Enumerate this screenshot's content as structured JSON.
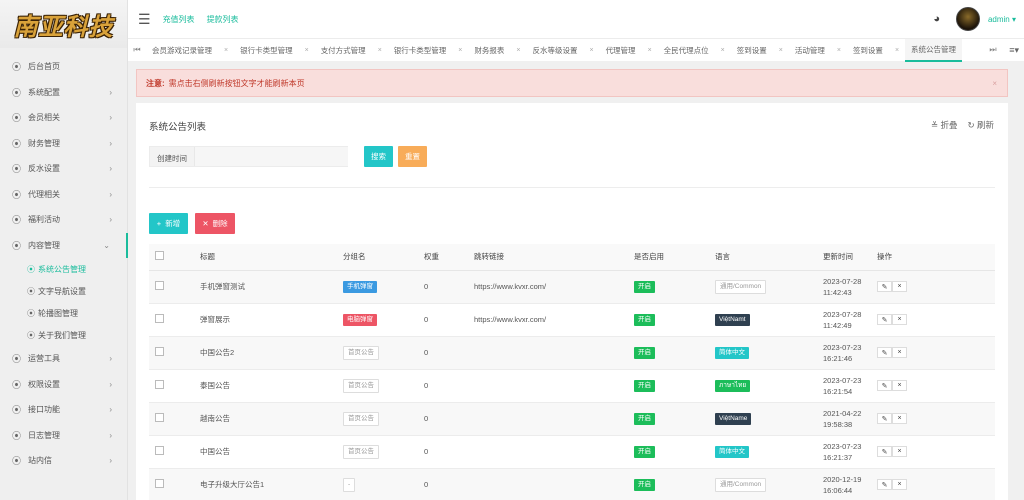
{
  "brand": {
    "logo_text": "南亚科技"
  },
  "header": {
    "links": [
      "充值列表",
      "提款列表"
    ],
    "user": "admin ▾"
  },
  "sidebar": {
    "items": [
      {
        "label": "后台首页",
        "has_arrow": false
      },
      {
        "label": "系统配置",
        "has_arrow": true
      },
      {
        "label": "会员相关",
        "has_arrow": true
      },
      {
        "label": "财务管理",
        "has_arrow": true
      },
      {
        "label": "反水设置",
        "has_arrow": true
      },
      {
        "label": "代理相关",
        "has_arrow": true
      },
      {
        "label": "福利活动",
        "has_arrow": true
      },
      {
        "label": "内容管理",
        "has_arrow": true,
        "open": true
      }
    ],
    "sub_items": [
      {
        "label": "系统公告管理",
        "active": true
      },
      {
        "label": "文字导航设置",
        "active": false
      },
      {
        "label": "轮播图管理",
        "active": false
      },
      {
        "label": "关于我们管理",
        "active": false
      }
    ],
    "items_after": [
      {
        "label": "运营工具",
        "has_arrow": true
      },
      {
        "label": "权限设置",
        "has_arrow": true
      },
      {
        "label": "接口功能",
        "has_arrow": true
      },
      {
        "label": "日志管理",
        "has_arrow": true
      },
      {
        "label": "站内信",
        "has_arrow": true
      }
    ]
  },
  "tabs": [
    "会员游戏记录管理",
    "银行卡类型管理",
    "支付方式管理",
    "银行卡类型管理",
    "财务报表",
    "反水等级设置",
    "代理管理",
    "全民代理点位",
    "签到设置",
    "活动管理",
    "签到设置",
    "系统公告管理"
  ],
  "notice": {
    "label": "注意:",
    "text": "需点击右侧刷新按钮文字才能刷新本页"
  },
  "panel": {
    "title": "系统公告列表",
    "collapse_label": "折叠",
    "refresh_label": "刷新",
    "search_label": "创建时间",
    "search_placeholder": "",
    "search_button": "搜索",
    "reset_button": "重置",
    "add_button": "新增",
    "delete_button": "删除"
  },
  "table": {
    "columns": [
      "标题",
      "分组名",
      "权重",
      "跳转链接",
      "是否启用",
      "语言",
      "更新时间",
      "操作"
    ],
    "rows": [
      {
        "title": "手机弹窗测试",
        "group": "手机弹窗",
        "group_style": "blue",
        "weight": "0",
        "link": "https://www.kvxr.com/",
        "enabled": "开启",
        "lang": "通用/Common",
        "lang_style": "white",
        "time1": "2023-07-28",
        "time2": "11:42:43"
      },
      {
        "title": "弹窗展示",
        "group": "电脑弹窗",
        "group_style": "red",
        "weight": "0",
        "link": "https://www.kvxr.com/",
        "enabled": "开启",
        "lang": "ViệtNamt",
        "lang_style": "dark",
        "time1": "2023-07-28",
        "time2": "11:42:49"
      },
      {
        "title": "中国公告2",
        "group": "首页公告",
        "group_style": "plain",
        "weight": "0",
        "link": "",
        "enabled": "开启",
        "lang": "简体中文",
        "lang_style": "teal",
        "time1": "2023-07-23",
        "time2": "16:21:46"
      },
      {
        "title": "泰国公告",
        "group": "首页公告",
        "group_style": "plain",
        "weight": "0",
        "link": "",
        "enabled": "开启",
        "lang": "ภาษาไทย",
        "lang_style": "green",
        "time1": "2023-07-23",
        "time2": "16:21:54"
      },
      {
        "title": "越南公告",
        "group": "首页公告",
        "group_style": "plain",
        "weight": "0",
        "link": "",
        "enabled": "开启",
        "lang": "ViệtName",
        "lang_style": "dark",
        "time1": "2021-04-22",
        "time2": "19:58:38"
      },
      {
        "title": "中国公告",
        "group": "首页公告",
        "group_style": "plain",
        "weight": "0",
        "link": "",
        "enabled": "开启",
        "lang": "简体中文",
        "lang_style": "teal",
        "time1": "2023-07-23",
        "time2": "16:21:37"
      },
      {
        "title": "电子升级大厅公告1",
        "group": "-",
        "group_style": "plain",
        "weight": "0",
        "link": "",
        "enabled": "开启",
        "lang": "通用/Common",
        "lang_style": "white",
        "time1": "2020-12-19",
        "time2": "16:06:44"
      }
    ]
  }
}
